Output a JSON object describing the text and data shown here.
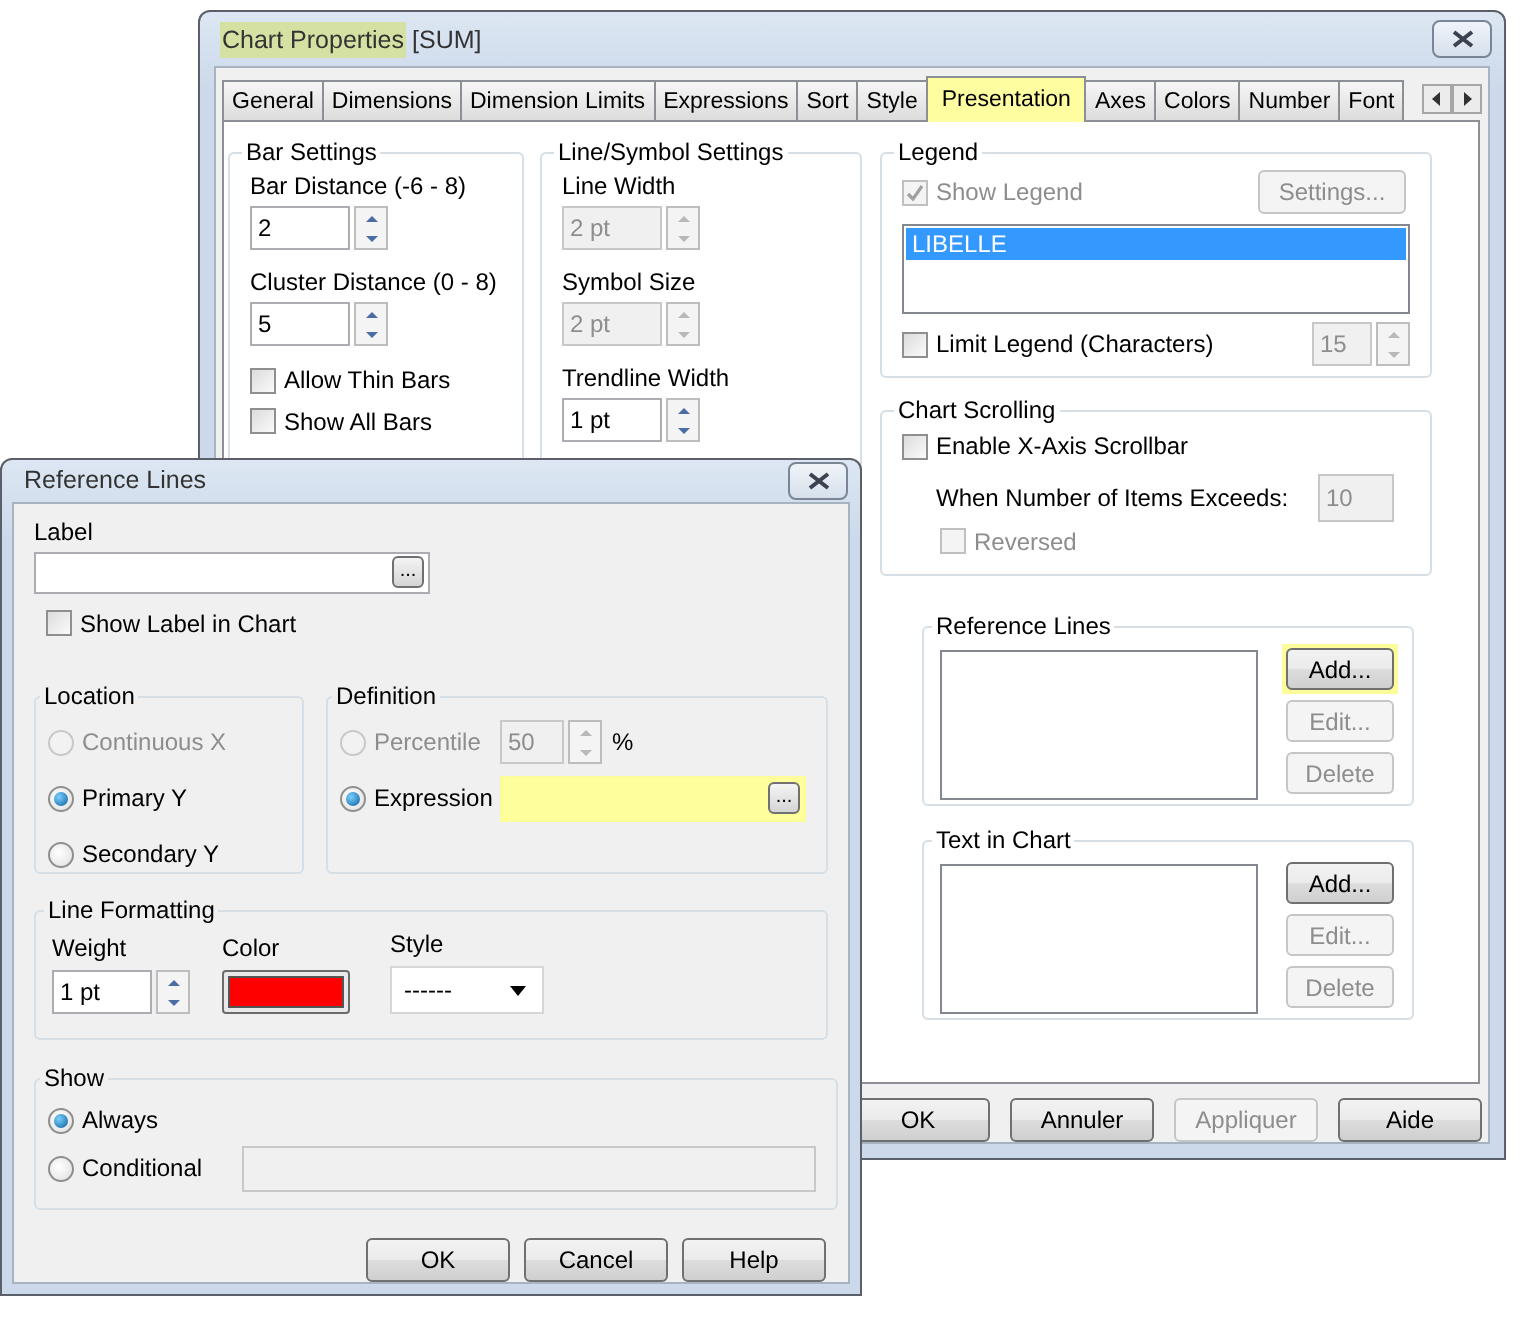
{
  "main_window": {
    "title": "Chart Properties",
    "title_highlighted": true,
    "subtitle": "[SUM]",
    "tabs": [
      {
        "label": "General",
        "selected": false,
        "highlighted": false
      },
      {
        "label": "Dimensions",
        "selected": false,
        "highlighted": false
      },
      {
        "label": "Dimension Limits",
        "selected": false,
        "highlighted": false
      },
      {
        "label": "Expressions",
        "selected": false,
        "highlighted": false
      },
      {
        "label": "Sort",
        "selected": false,
        "highlighted": false
      },
      {
        "label": "Style",
        "selected": false,
        "highlighted": false
      },
      {
        "label": "Presentation",
        "selected": true,
        "highlighted": true
      },
      {
        "label": "Axes",
        "selected": false,
        "highlighted": false
      },
      {
        "label": "Colors",
        "selected": false,
        "highlighted": false
      },
      {
        "label": "Number",
        "selected": false,
        "highlighted": false
      },
      {
        "label": "Font",
        "selected": false,
        "highlighted": false
      }
    ],
    "bar_settings": {
      "title": "Bar Settings",
      "fields": [
        {
          "label": "Bar Distance (-6 - 8)",
          "value": "2",
          "disabled": false
        },
        {
          "label": "Cluster Distance (0 - 8)",
          "value": "5",
          "disabled": false
        }
      ],
      "checkboxes": [
        {
          "label": "Allow Thin Bars",
          "checked": false
        },
        {
          "label": "Show All Bars",
          "checked": false
        }
      ]
    },
    "line_symbol_settings": {
      "title": "Line/Symbol Settings",
      "fields": [
        {
          "label": "Line Width",
          "value": "2 pt",
          "disabled": true
        },
        {
          "label": "Symbol Size",
          "value": "2 pt",
          "disabled": true
        },
        {
          "label": "Trendline Width",
          "value": "1 pt",
          "disabled": false
        }
      ]
    },
    "legend": {
      "title": "Legend",
      "show_legend": {
        "label": "Show Legend",
        "checked": true,
        "disabled": true
      },
      "settings_button": {
        "label": "Settings...",
        "disabled": true
      },
      "items": [
        {
          "label": "LIBELLE",
          "selected": true
        }
      ],
      "limit_legend": {
        "label": "Limit Legend (Characters)",
        "checked": false
      },
      "limit_value": "15"
    },
    "chart_scrolling": {
      "title": "Chart Scrolling",
      "enable": {
        "label": "Enable X-Axis Scrollbar",
        "checked": false
      },
      "threshold_label": "When Number of Items Exceeds:",
      "threshold_value": "10",
      "reversed": {
        "label": "Reversed",
        "checked": false,
        "disabled": true
      }
    },
    "reference_lines": {
      "title": "Reference Lines",
      "buttons": [
        {
          "label": "Add...",
          "disabled": false,
          "highlighted": true
        },
        {
          "label": "Edit...",
          "disabled": true,
          "highlighted": false
        },
        {
          "label": "Delete",
          "disabled": true,
          "highlighted": false
        }
      ]
    },
    "text_in_chart": {
      "title": "Text in Chart",
      "buttons": [
        {
          "label": "Add...",
          "disabled": false,
          "highlighted": false
        },
        {
          "label": "Edit...",
          "disabled": true,
          "highlighted": false
        },
        {
          "label": "Delete",
          "disabled": true,
          "highlighted": false
        }
      ]
    },
    "buttons": [
      {
        "label": "OK",
        "disabled": false
      },
      {
        "label": "Annuler",
        "disabled": false
      },
      {
        "label": "Appliquer",
        "disabled": true
      },
      {
        "label": "Aide",
        "disabled": false
      }
    ]
  },
  "reference_dialog": {
    "title": "Reference Lines",
    "label_caption": "Label",
    "browse_label": "...",
    "show_label": {
      "label": "Show Label in Chart",
      "checked": false
    },
    "location": {
      "title": "Location",
      "options": [
        {
          "label": "Continuous X",
          "selected": false,
          "disabled": true
        },
        {
          "label": "Primary Y",
          "selected": true,
          "disabled": false
        },
        {
          "label": "Secondary Y",
          "selected": false,
          "disabled": false
        }
      ]
    },
    "definition": {
      "title": "Definition",
      "percentile": {
        "label": "Percentile",
        "selected": false,
        "disabled": true,
        "value": "50",
        "unit": "%"
      },
      "expression": {
        "label": "Expression",
        "selected": true,
        "highlighted": true
      }
    },
    "line_formatting": {
      "title": "Line Formatting",
      "weight_label": "Weight",
      "weight": "1 pt",
      "color_label": "Color",
      "color": "#ff0000",
      "style_label": "Style",
      "style": "------"
    },
    "show": {
      "title": "Show",
      "options": [
        {
          "label": "Always",
          "selected": true
        },
        {
          "label": "Conditional",
          "selected": false
        }
      ]
    },
    "buttons": [
      {
        "label": "OK",
        "disabled": false
      },
      {
        "label": "Cancel",
        "disabled": false
      },
      {
        "label": "Help",
        "disabled": false
      }
    ]
  }
}
